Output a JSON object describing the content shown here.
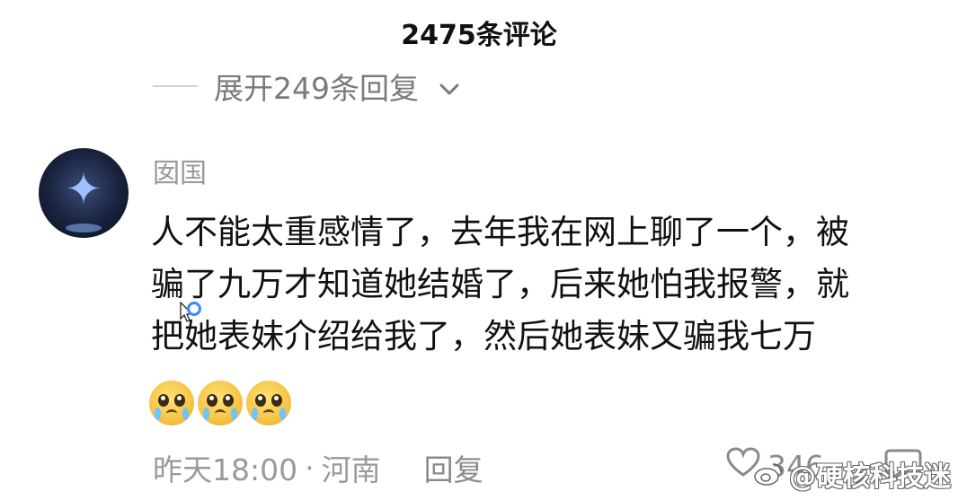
{
  "header": {
    "title": "2475条评论"
  },
  "thread": {
    "expand_label": "展开249条回复"
  },
  "comment": {
    "username": "囡国",
    "text_lines": [
      "人不能太重感情了，去年我在网上聊了一个，被",
      "骗了九万才知道她结婚了，后来她怕我报警，就",
      "把她表妹介绍给我了，然后她表妹又骗我七万"
    ],
    "emojis": [
      "crying-face",
      "crying-face",
      "crying-face"
    ],
    "timestamp": "昨天18:00",
    "separator": "·",
    "location": "河南",
    "reply_label": "回复",
    "like_count": "346"
  },
  "watermark": {
    "text": "@硬核科技迷"
  },
  "colors": {
    "primary_text": "#111111",
    "secondary_text": "#9a9a9a",
    "cursor_blue": "#3b8bff"
  },
  "icons": {
    "expand": "chevron-down-icon",
    "like": "heart-icon",
    "comment": "comment-icon",
    "watermark_logo": "weibo-logo-icon"
  }
}
